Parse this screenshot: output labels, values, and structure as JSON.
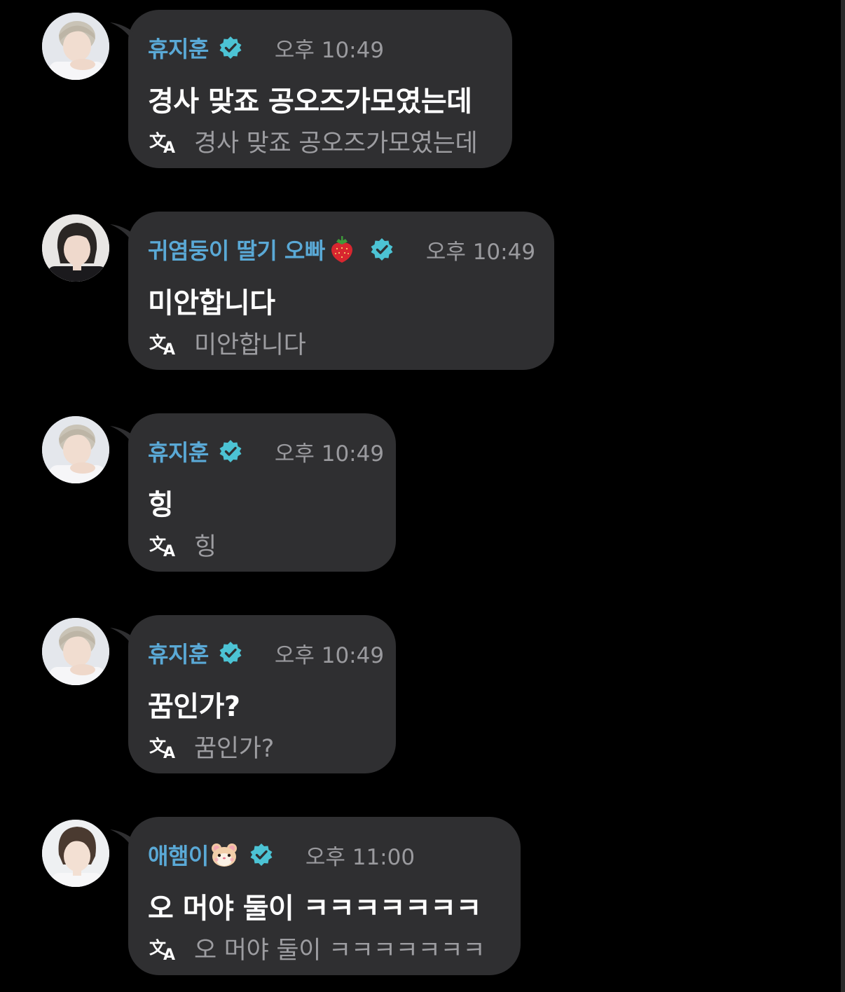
{
  "messages": [
    {
      "sender": "휴지훈",
      "sender_emoji": "",
      "time": "오후 10:49",
      "text": "경사 맞죠 공오즈가모였는데",
      "translation": "경사 맞죠 공오즈가모였는데",
      "avatar": "avatar-hyujihun"
    },
    {
      "sender": "귀염둥이 딸기 오빠",
      "sender_emoji": "strawberry-emoji",
      "time": "오후 10:49",
      "text": "미안합니다",
      "translation": "미안합니다",
      "avatar": "avatar-strawberry"
    },
    {
      "sender": "휴지훈",
      "sender_emoji": "",
      "time": "오후 10:49",
      "text": "힝",
      "translation": "힝",
      "avatar": "avatar-hyujihun"
    },
    {
      "sender": "휴지훈",
      "sender_emoji": "",
      "time": "오후 10:49",
      "text": "꿈인가?",
      "translation": "꿈인가?",
      "avatar": "avatar-hyujihun"
    },
    {
      "sender": "애햄이",
      "sender_emoji": "hamster-emoji",
      "time": "오후 11:00",
      "text": "오 머야 둘이 ㅋㅋㅋㅋㅋㅋㅋ",
      "translation": "오 머야 둘이 ㅋㅋㅋㅋㅋㅋㅋ",
      "avatar": "avatar-aehaem"
    }
  ],
  "colors": {
    "background": "#000000",
    "bubble": "#2f2f31",
    "sender_name": "#5aa9d6",
    "verified_badge": "#4cc3d4",
    "timestamp": "#9a9a9e",
    "message_text": "#ffffff",
    "translation_text": "#9d9da1"
  },
  "icons": {
    "verified": "verified-badge-icon",
    "translate": "translate-icon"
  }
}
